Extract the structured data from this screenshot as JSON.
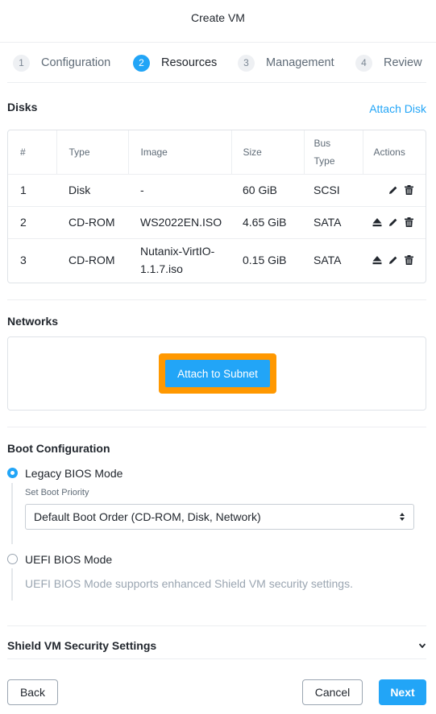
{
  "window": {
    "title": "Create VM"
  },
  "steps": [
    {
      "num": "1",
      "label": "Configuration"
    },
    {
      "num": "2",
      "label": "Resources"
    },
    {
      "num": "3",
      "label": "Management"
    },
    {
      "num": "4",
      "label": "Review"
    }
  ],
  "active_step": 2,
  "disks": {
    "title": "Disks",
    "attach_link": "Attach Disk",
    "columns": {
      "idx": "#",
      "type": "Type",
      "image": "Image",
      "size": "Size",
      "bus_line1": "Bus",
      "bus_line2": "Type",
      "actions": "Actions"
    },
    "rows": [
      {
        "idx": "1",
        "type": "Disk",
        "image": "-",
        "size": "60 GiB",
        "bus": "SCSI",
        "actions": [
          "edit-icon",
          "delete-icon"
        ]
      },
      {
        "idx": "2",
        "type": "CD-ROM",
        "image": "WS2022EN.ISO",
        "size": "4.65 GiB",
        "bus": "SATA",
        "actions": [
          "eject-icon",
          "edit-icon",
          "delete-icon"
        ]
      },
      {
        "idx": "3",
        "type": "CD-ROM",
        "image_line1": "Nutanix-VirtIO-",
        "image_line2": "1.1.7.iso",
        "size": "0.15 GiB",
        "bus": "SATA",
        "actions": [
          "eject-icon",
          "edit-icon",
          "delete-icon"
        ]
      }
    ]
  },
  "networks": {
    "title": "Networks",
    "attach_button": "Attach to Subnet"
  },
  "boot": {
    "title": "Boot Configuration",
    "legacy_label": "Legacy BIOS Mode",
    "legacy_selected": true,
    "priority_label": "Set Boot Priority",
    "priority_value": "Default Boot Order (CD-ROM, Disk, Network)",
    "uefi_label": "UEFI BIOS Mode",
    "uefi_hint": "UEFI BIOS Mode supports enhanced Shield VM security settings."
  },
  "shield": {
    "title": "Shield VM Security Settings"
  },
  "footer": {
    "back": "Back",
    "cancel": "Cancel",
    "next": "Next"
  },
  "colors": {
    "accent": "#22a5f7",
    "highlight": "#ff9800",
    "text": "#22272e",
    "muted": "#5f6b77"
  }
}
